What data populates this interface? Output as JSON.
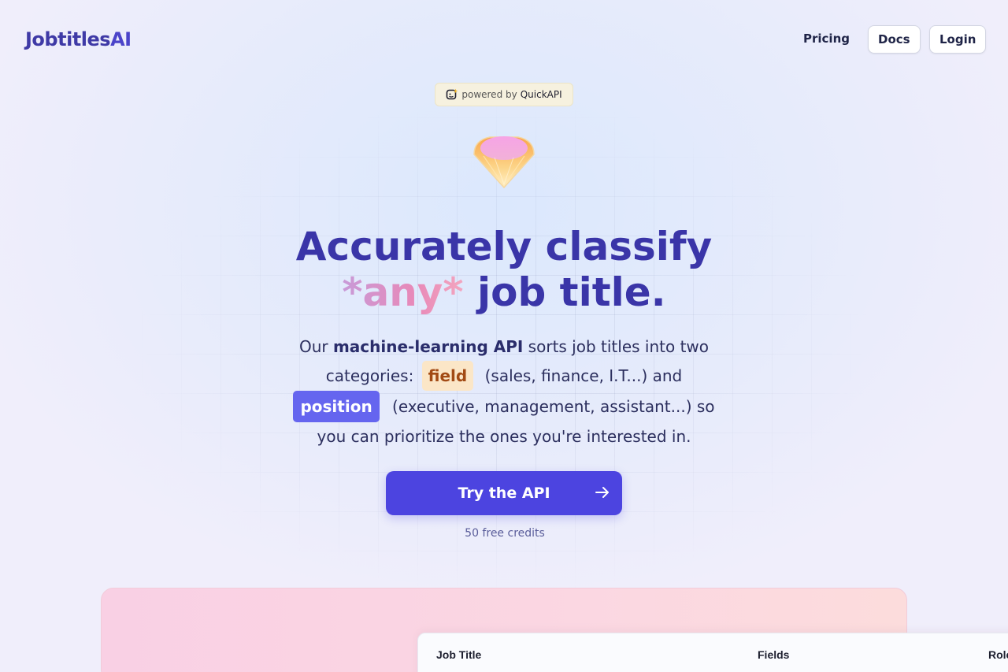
{
  "nav": {
    "logo_main": "Jobtitles",
    "logo_ai": "AI",
    "pricing": "Pricing",
    "docs": "Docs",
    "login": "Login"
  },
  "badge": {
    "prefix": "powered by",
    "brand": "QuickAPI",
    "icon": "quickapi-logo-icon"
  },
  "hero": {
    "gem_icon": "gem-icon",
    "title_line1": "Accurately classify",
    "title_any": "*any*",
    "title_line2_rest": "job title.",
    "desc_1": "Our ",
    "desc_bold": "machine-learning API",
    "desc_2": " sorts job titles into two categories: ",
    "tag_field": "field",
    "desc_3": " (sales, finance, I.T...) and ",
    "tag_position": "position",
    "desc_4": " (executive, management, assistant...) so you can prioritize the ones you're interested in."
  },
  "cta": {
    "label": "Try the API",
    "icon": "arrow-right-icon",
    "subtext": "50 free credits"
  },
  "table": {
    "columns": [
      "Job Title",
      "Fields",
      "Role"
    ]
  },
  "colors": {
    "brand": "#3f3aa6",
    "cta": "#4c44e0",
    "tag_field_bg": "#fbe6c7",
    "tag_position_bg": "#6565ef"
  }
}
